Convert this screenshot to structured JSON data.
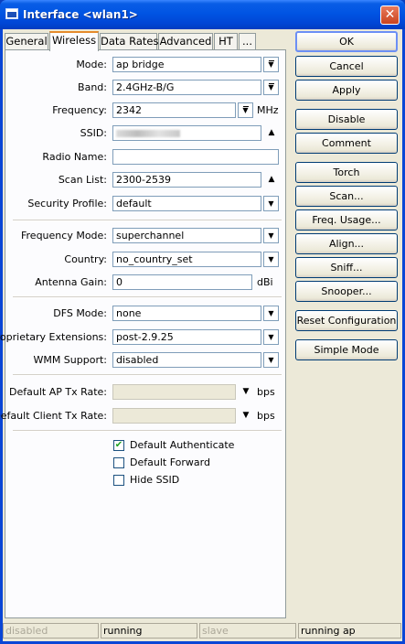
{
  "window": {
    "title": "Interface <wlan1>"
  },
  "tabs": [
    "General",
    "Wireless",
    "Data Rates",
    "Advanced",
    "HT",
    "..."
  ],
  "fields": {
    "mode": {
      "label": "Mode:",
      "value": "ap bridge"
    },
    "band": {
      "label": "Band:",
      "value": "2.4GHz-B/G"
    },
    "frequency": {
      "label": "Frequency:",
      "value": "2342",
      "unit": "MHz"
    },
    "ssid": {
      "label": "SSID:",
      "value": ""
    },
    "radio_name": {
      "label": "Radio Name:",
      "value": ""
    },
    "scan_list": {
      "label": "Scan List:",
      "value": "2300-2539"
    },
    "security_profile": {
      "label": "Security Profile:",
      "value": "default"
    },
    "frequency_mode": {
      "label": "Frequency Mode:",
      "value": "superchannel"
    },
    "country": {
      "label": "Country:",
      "value": "no_country_set"
    },
    "antenna_gain": {
      "label": "Antenna Gain:",
      "value": "0",
      "unit": "dBi"
    },
    "dfs_mode": {
      "label": "DFS Mode:",
      "value": "none"
    },
    "proprietary_extensions": {
      "label": "Proprietary Extensions:",
      "value": "post-2.9.25"
    },
    "wmm_support": {
      "label": "WMM Support:",
      "value": "disabled"
    },
    "default_ap_tx_rate": {
      "label": "Default AP Tx Rate:",
      "value": "",
      "unit": "bps"
    },
    "default_client_tx_rate": {
      "label": "Default Client Tx Rate:",
      "value": "",
      "unit": "bps"
    }
  },
  "checkboxes": [
    {
      "label": "Default Authenticate",
      "checked": true
    },
    {
      "label": "Default Forward",
      "checked": false
    },
    {
      "label": "Hide SSID",
      "checked": false
    }
  ],
  "buttons": {
    "ok": "OK",
    "cancel": "Cancel",
    "apply": "Apply",
    "disable": "Disable",
    "comment": "Comment",
    "torch": "Torch",
    "scan": "Scan...",
    "freq_usage": "Freq. Usage...",
    "align": "Align...",
    "sniff": "Sniff...",
    "snooper": "Snooper...",
    "reset_configuration": "Reset Configuration",
    "simple_mode": "Simple Mode"
  },
  "status": [
    "disabled",
    "running",
    "slave",
    "running ap"
  ]
}
